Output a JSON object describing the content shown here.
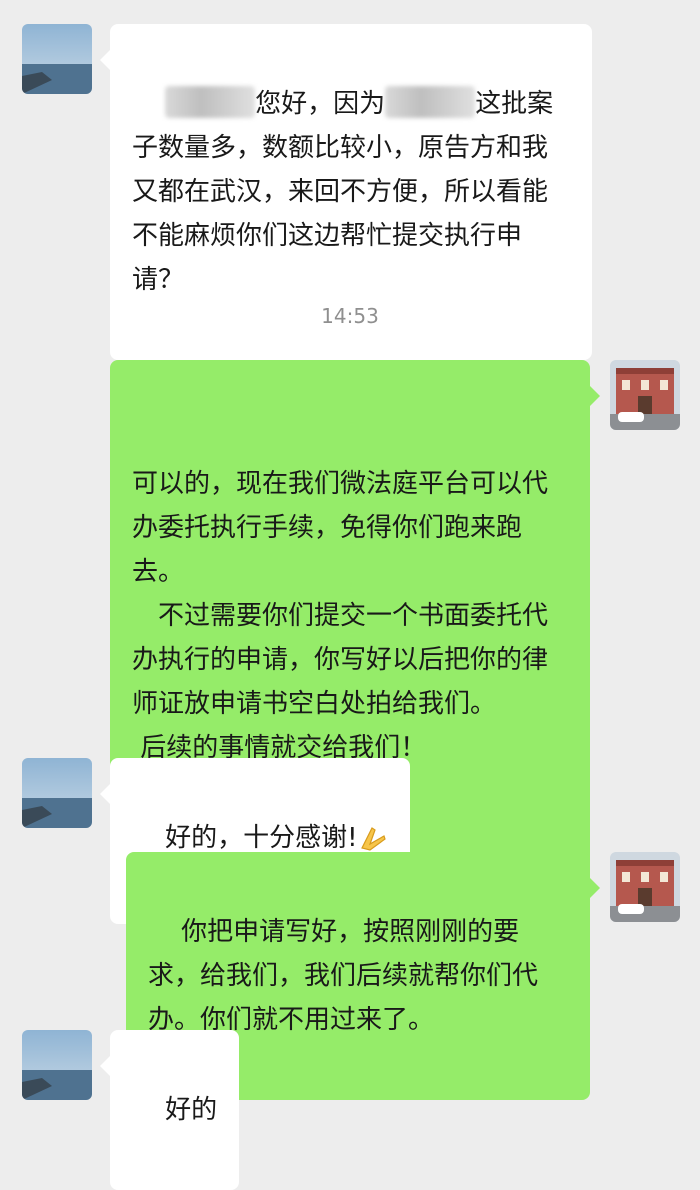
{
  "messages": [
    {
      "side": "in",
      "paragraphs": [
        "您好，因为",
        "这批案子数量多，数额比较小，原告方和我又都在武汉，来回不方便，所以看能不能麻烦你们这边帮忙提交执行申请？"
      ]
    },
    {
      "timestamp": "14:53"
    },
    {
      "side": "out",
      "paragraphs": [
        "可以的，现在我们微法庭平台可以代办委托执行手续，免得你们跑来跑去。",
        "　不过需要你们提交一个书面委托代办执行的申请，你写好以后把你的律师证放申请书空白处拍给我们。",
        " 后续的事情就交给我们！"
      ]
    },
    {
      "side": "in",
      "paragraphs": [
        "好的，十分感谢!"
      ],
      "emoji": "folded-hands"
    },
    {
      "side": "out",
      "paragraphs": [
        "你把申请写好，按照刚刚的要求，给我们，我们后续就帮你们代办。你们就不用过来了。"
      ]
    },
    {
      "side": "in",
      "paragraphs": [
        "好的"
      ]
    }
  ],
  "colors": {
    "background": "#ededed",
    "incoming_bubble": "#ffffff",
    "outgoing_bubble": "#95ec69",
    "timestamp": "#8f8f8f"
  }
}
